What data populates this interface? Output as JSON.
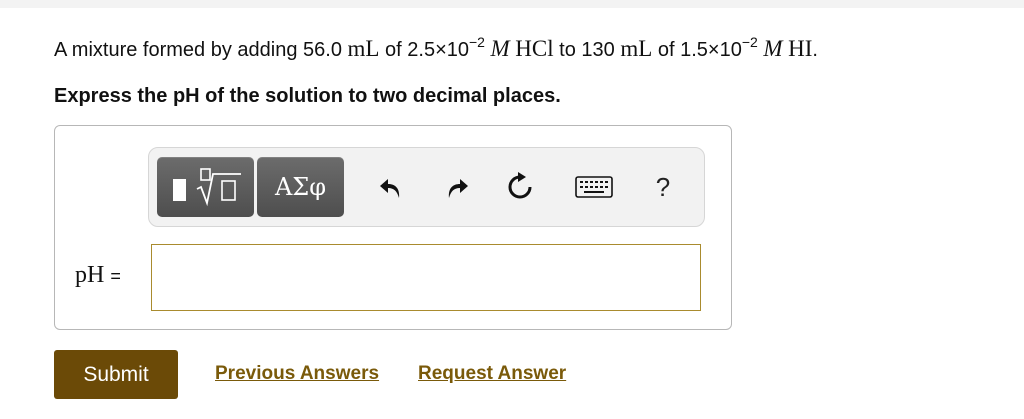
{
  "problem": {
    "prefix": "A mixture formed by adding 56.0",
    "unit1": "mL",
    "of1": "of 2.5×10",
    "exp1": "−2",
    "molar1": "M",
    "acid1": "HCl",
    "to": "to 130",
    "unit2": "mL",
    "of2": "of 1.5×10",
    "exp2": "−2",
    "molar2": "M",
    "acid2": "HI",
    "end": "."
  },
  "instruction": "Express the pH of the solution to two decimal places.",
  "toolbar": {
    "greek_label": "ΑΣφ",
    "help_label": "?"
  },
  "answer": {
    "label": "pH",
    "equals": "=",
    "value": ""
  },
  "actions": {
    "submit_label": "Submit",
    "previous_label": "Previous Answers",
    "request_label": "Request Answer"
  },
  "colors": {
    "submit_bg": "#6b4a07",
    "link": "#7a5a0a",
    "input_border": "#a98b2e"
  }
}
